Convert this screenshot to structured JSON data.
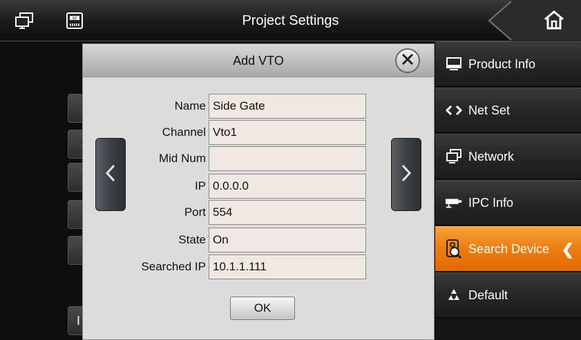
{
  "header": {
    "title": "Project Settings",
    "left_icons": [
      "network-icon",
      "sd-card-icon"
    ],
    "home_icon": "home-icon"
  },
  "sidebar": {
    "items": [
      {
        "label": "Product Info",
        "icon": "monitor-icon",
        "active": false
      },
      {
        "label": "Net Set",
        "icon": "code-arrows-icon",
        "active": false
      },
      {
        "label": "Network",
        "icon": "network-icon",
        "active": false
      },
      {
        "label": "IPC Info",
        "icon": "camera-icon",
        "active": false
      },
      {
        "label": "Search Device",
        "icon": "search-device-icon",
        "active": true
      },
      {
        "label": "Default",
        "icon": "recycle-icon",
        "active": false
      }
    ],
    "accent_color": "#ec7d10"
  },
  "modal": {
    "title": "Add VTO",
    "fields": [
      {
        "label": "Name",
        "value": "Side Gate"
      },
      {
        "label": "Channel",
        "value": "Vto1"
      },
      {
        "label": "Mid Num",
        "value": ""
      },
      {
        "label": "IP",
        "value": "0.0.0.0"
      },
      {
        "label": "Port",
        "value": "554"
      },
      {
        "label": "State",
        "value": "On"
      },
      {
        "label": "Searched IP",
        "value": "10.1.1.111"
      }
    ],
    "ok_label": "OK"
  },
  "background": {
    "partial_label": "I"
  }
}
